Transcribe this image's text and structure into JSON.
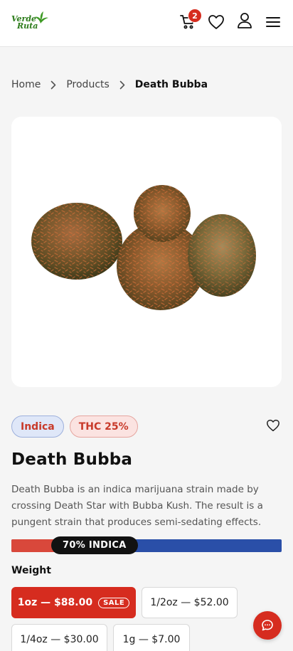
{
  "header": {
    "logo_line1": "Verde",
    "logo_line2": "Ruta",
    "cart_count": "2",
    "icons": [
      "cart-icon",
      "heart-icon",
      "user-icon",
      "menu-icon"
    ]
  },
  "breadcrumb": [
    "Home",
    "Products",
    "Death Bubba"
  ],
  "product": {
    "tags": [
      "Indica",
      "THC 25%"
    ],
    "name": "Death Bubba",
    "description": "Death Bubba is an indica marijuana strain made by crossing Death Star with Bubba Kush. The result is a pungent strain that produces semi-sedating effects.",
    "indica_fraction": 0.7,
    "strain_label": "70% INDICA",
    "weight_label": "Weight",
    "options": [
      {
        "label": "1oz — $88.00",
        "selected": true,
        "badge": "SALE"
      },
      {
        "label": "1/2oz — $52.00",
        "selected": false
      },
      {
        "label": "1/4oz — $30.00",
        "selected": false
      },
      {
        "label": "1g — $7.00",
        "selected": false
      }
    ]
  },
  "colors": {
    "accent": "#d62c1f",
    "indica_blue": "#2a4fa8",
    "logo_green": "#2f7d1f"
  }
}
